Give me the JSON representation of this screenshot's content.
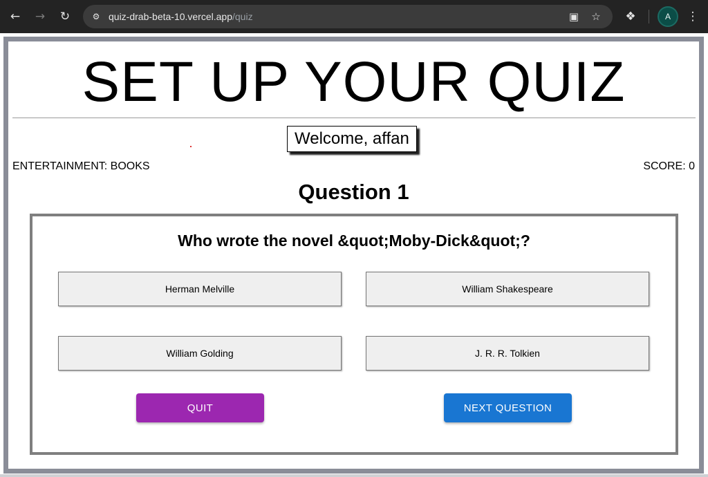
{
  "browser": {
    "url_host": "quiz-drab-beta-10.vercel.app",
    "url_path": "/quiz",
    "avatar_letter": "A"
  },
  "page": {
    "title": "SET UP YOUR QUIZ",
    "welcome": "Welcome, affan",
    "category": "ENTERTAINMENT: BOOKS",
    "score": "SCORE: 0",
    "question_number": "Question 1",
    "question": "Who wrote the novel &quot;Moby-Dick&quot;?",
    "answers": [
      "Herman Melville",
      "William Shakespeare",
      "William Golding",
      "J. R. R. Tolkien"
    ],
    "quit_label": "QUIT",
    "next_label": "NEXT QUESTION"
  },
  "colors": {
    "quit": "#9c27b0",
    "next": "#1976d2",
    "frame": "#8a8d98"
  }
}
